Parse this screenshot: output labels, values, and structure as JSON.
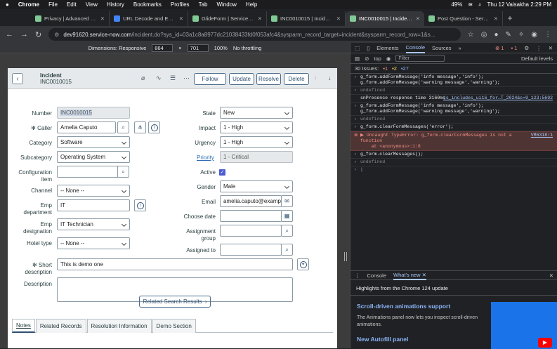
{
  "menubar": {
    "app": "Chrome",
    "items": [
      "File",
      "Edit",
      "View",
      "History",
      "Bookmarks",
      "Profiles",
      "Tab",
      "Window",
      "Help"
    ],
    "battery": "49%",
    "datetime": "Thu 12 Vaisakha  2:29 PM"
  },
  "tabs": [
    {
      "title": "Privacy | Advanced Obj"
    },
    {
      "title": "URL Decode and Encod"
    },
    {
      "title": "GlideForm | ServiceNow"
    },
    {
      "title": "INC0010015 | Incident |"
    },
    {
      "title": "INC0010015 | Incident |"
    },
    {
      "title": "Post Question - Service"
    }
  ],
  "url": {
    "host": "dev91620.service-now.com",
    "path": "/incident.do?sys_id=03a1c8a8977dc21038433fd0f053afc4&sysparm_record_target=incident&sysparm_record_row=1&s..."
  },
  "device_toolbar": {
    "dimensions": "Dimensions: Responsive",
    "width": "864",
    "height": "701",
    "zoom": "100%",
    "throttle": "No throttling"
  },
  "form": {
    "header": {
      "title": "Incident",
      "number": "INC0010015"
    },
    "buttons": {
      "follow": "Follow",
      "update": "Update",
      "resolve": "Resolve",
      "delete": "Delete"
    },
    "labels": {
      "number": "Number",
      "caller": "Caller",
      "category": "Category",
      "subcategory": "Subcategory",
      "ci1": "Configuration",
      "ci2": "item",
      "channel": "Channel",
      "empdept1": "Emp",
      "empdept2": "department",
      "empdesig1": "Emp",
      "empdesig2": "designation",
      "hotel": "Hotel type",
      "state": "State",
      "impact": "Impact",
      "urgency": "Urgency",
      "priority": "Priority",
      "active": "Active",
      "gender": "Gender",
      "email": "Email",
      "choosedate": "Choose date",
      "ag1": "Assignment",
      "ag2": "group",
      "assigned": "Assigned to",
      "short1": "Short",
      "short2": "description",
      "description": "Description"
    },
    "values": {
      "number": "INC0010015",
      "caller": "Amelia Caputo",
      "category": "Software",
      "subcategory": "Operating System",
      "ci": "",
      "channel": "-- None --",
      "empdept": "IT",
      "empdesig": "IT Technician",
      "hotel": "-- None --",
      "state": "New",
      "impact": "1 - High",
      "urgency": "1 - High",
      "priority": "1 - Critical",
      "gender": "Male",
      "email": "amelia.caputo@example",
      "choosedate": "",
      "ag": "",
      "assigned": "",
      "short": "This is demo one",
      "description": ""
    },
    "related": "Related Search Results",
    "tabs": [
      "Notes",
      "Related Records",
      "Resolution Information",
      "Demo Section"
    ]
  },
  "devtools": {
    "tabs": {
      "elements": "Elements",
      "console": "Console",
      "sources": "Sources",
      "more": "»",
      "errors": "1",
      "warnings": "1"
    },
    "toolbar": {
      "context": "top",
      "filter": "Filter",
      "levels": "Default levels"
    },
    "issues": {
      "label": "30 Issues:",
      "errors": "1",
      "warnings": "2",
      "info": "27"
    },
    "console": [
      {
        "type": "input",
        "text": "g_form.addFormMessage('info message','info');\ng_form.addFormMessage('warning message','warning');"
      },
      {
        "type": "undefined",
        "text": "undefined"
      },
      {
        "type": "log",
        "text": "snPresence response time 3160ms",
        "src": "js_includes_ui16_for…T_2024&c=9_123:5692"
      },
      {
        "type": "input",
        "text": "g_form.addFormMessage('info message','info');\ng_form.addFormMessage('warning message','warning');"
      },
      {
        "type": "undefined",
        "text": "undefined"
      },
      {
        "type": "input",
        "text": "g_form.clearFormMessages('error');"
      },
      {
        "type": "error",
        "text": "▶ Uncaught TypeError: g_form.clearFormMessages is not a\nfunction\n    at <anonymous>:1:8",
        "src": "VM6318:1"
      },
      {
        "type": "input",
        "text": "g_form.clearMessages();"
      },
      {
        "type": "undefined",
        "text": "undefined"
      }
    ],
    "drawer": {
      "tab1": "Console",
      "tab2": "What's new",
      "headline": "Highlights from the Chrome 124 update",
      "h1": "Scroll-driven animations support",
      "p1": "The Animations panel now lets you inspect scroll-driven animations.",
      "h2": "New Autofill panel"
    }
  }
}
